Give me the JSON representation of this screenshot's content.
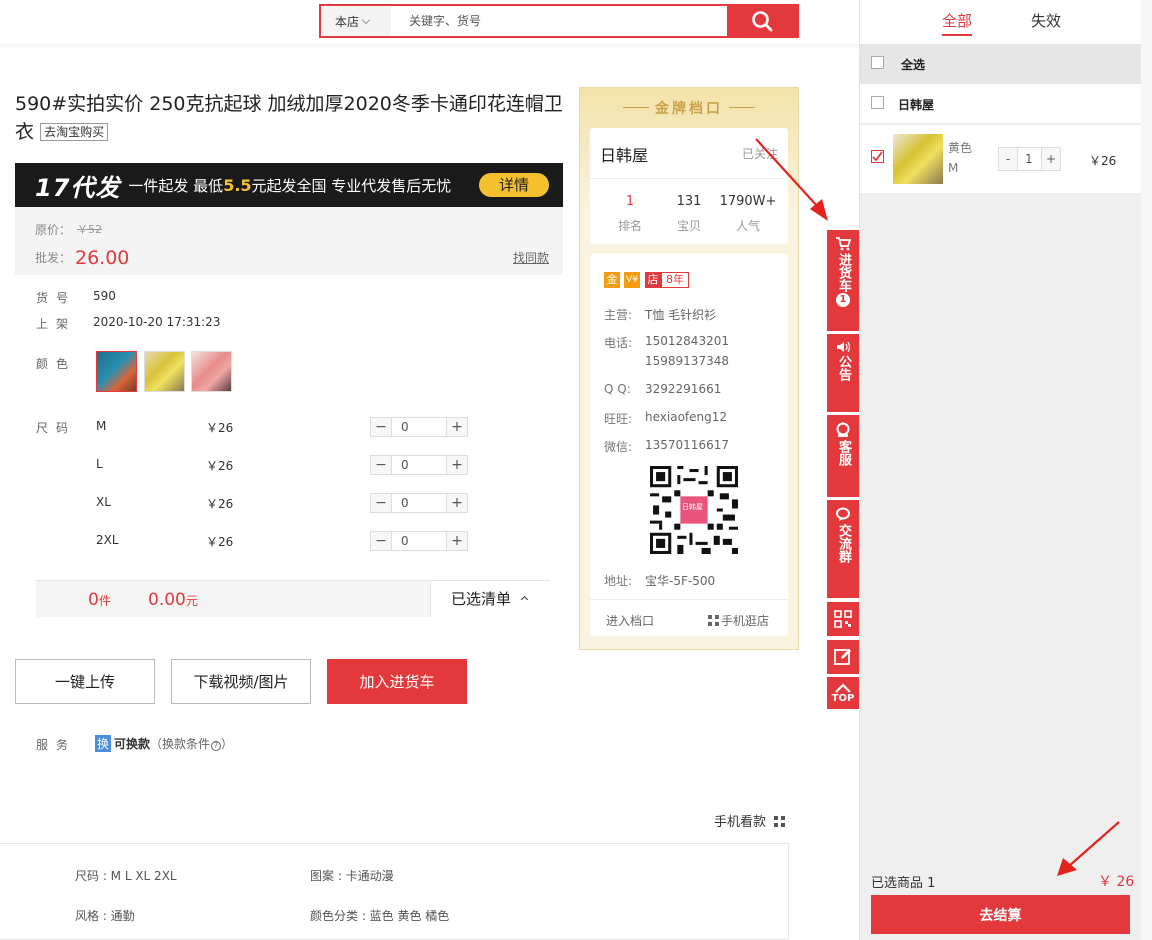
{
  "search": {
    "scope": "本店",
    "placeholder": "关键字、货号"
  },
  "product": {
    "title": "590#实拍实价 250克抗起球 加绒加厚2020冬季卡通印花连帽卫衣",
    "taobao_tag": "去淘宝购买",
    "banner": {
      "big": "17代发",
      "text_before": "一件起发 最低",
      "highlight": "5.5",
      "text_after": "元起发全国 专业代发售后无忧",
      "button": "详情"
    },
    "orig_label": "原价：",
    "orig_price": "￥52",
    "price_label": "批发：",
    "price": "26.00",
    "same_link": "找同款",
    "sku_label": "货号",
    "sku": "590",
    "listed_label": "上架",
    "listed": "2020-10-20 17:31:23",
    "color_label": "颜色",
    "colors": [
      "thumb-teal",
      "thumb-yellow",
      "thumb-pink"
    ],
    "size_label": "尺码",
    "sizes": [
      {
        "name": "M",
        "price": "￥26",
        "qty": "0"
      },
      {
        "name": "L",
        "price": "￥26",
        "qty": "0"
      },
      {
        "name": "XL",
        "price": "￥26",
        "qty": "0"
      },
      {
        "name": "2XL",
        "price": "￥26",
        "qty": "0"
      }
    ],
    "summary": {
      "count": "0",
      "count_unit": "件",
      "amount": "0.00",
      "amount_unit": "元",
      "list": "已选清单"
    },
    "buttons": {
      "upload": "一键上传",
      "download": "下载视频/图片",
      "add_cart": "加入进货车"
    },
    "service_label": "服务",
    "service_tag": "换",
    "service_text": "可换款",
    "service_cond": "（换款条件",
    "mobile_view": "手机看款",
    "details": [
      {
        "label": "尺码 : M L XL 2XL"
      },
      {
        "label": "图案 : 卡通动漫"
      },
      {
        "label": "风格 : 通勤"
      },
      {
        "label": "颜色分类 : 蓝色 黄色 橘色"
      }
    ]
  },
  "shop": {
    "ribbon": "金牌档口",
    "name": "日韩屋",
    "follow": "已关注",
    "stats": [
      {
        "value": "1",
        "label": "排名"
      },
      {
        "value": "131",
        "label": "宝贝"
      },
      {
        "value": "1790W+",
        "label": "人气"
      }
    ],
    "badges": {
      "gold": "金",
      "pay": "V¥",
      "store": "店",
      "years": "8年"
    },
    "main_label": "主营:",
    "main": "T恤 毛针织衫",
    "phone_label": "电话:",
    "phone1": "15012843201",
    "phone2": "15989137348",
    "qq_label": "Q  Q:",
    "qq": "3292291661",
    "ww_label": "旺旺:",
    "ww": "hexiaofeng12",
    "wx_label": "微信:",
    "wx": "13570116617",
    "qr_text": "日韩屋",
    "addr_label": "地址:",
    "addr": "宝华-5F-500",
    "enter": "进入档口",
    "mobile": "手机逛店"
  },
  "toolbar": {
    "cart": "进货车",
    "cart_count": "1",
    "notice": "公告",
    "service": "客服",
    "group": "交流群",
    "top": "TOP"
  },
  "cart": {
    "tab_all": "全部",
    "tab_invalid": "失效",
    "select_all": "全选",
    "shop": "日韩屋",
    "item": {
      "color": "黄色",
      "size": "M",
      "qty": "1",
      "price": "￥26"
    },
    "selected": "已选商品 1",
    "total": "￥ 26",
    "checkout": "去结算"
  },
  "colors": {
    "accent": "#e4393c",
    "gold": "#c9a24a"
  }
}
